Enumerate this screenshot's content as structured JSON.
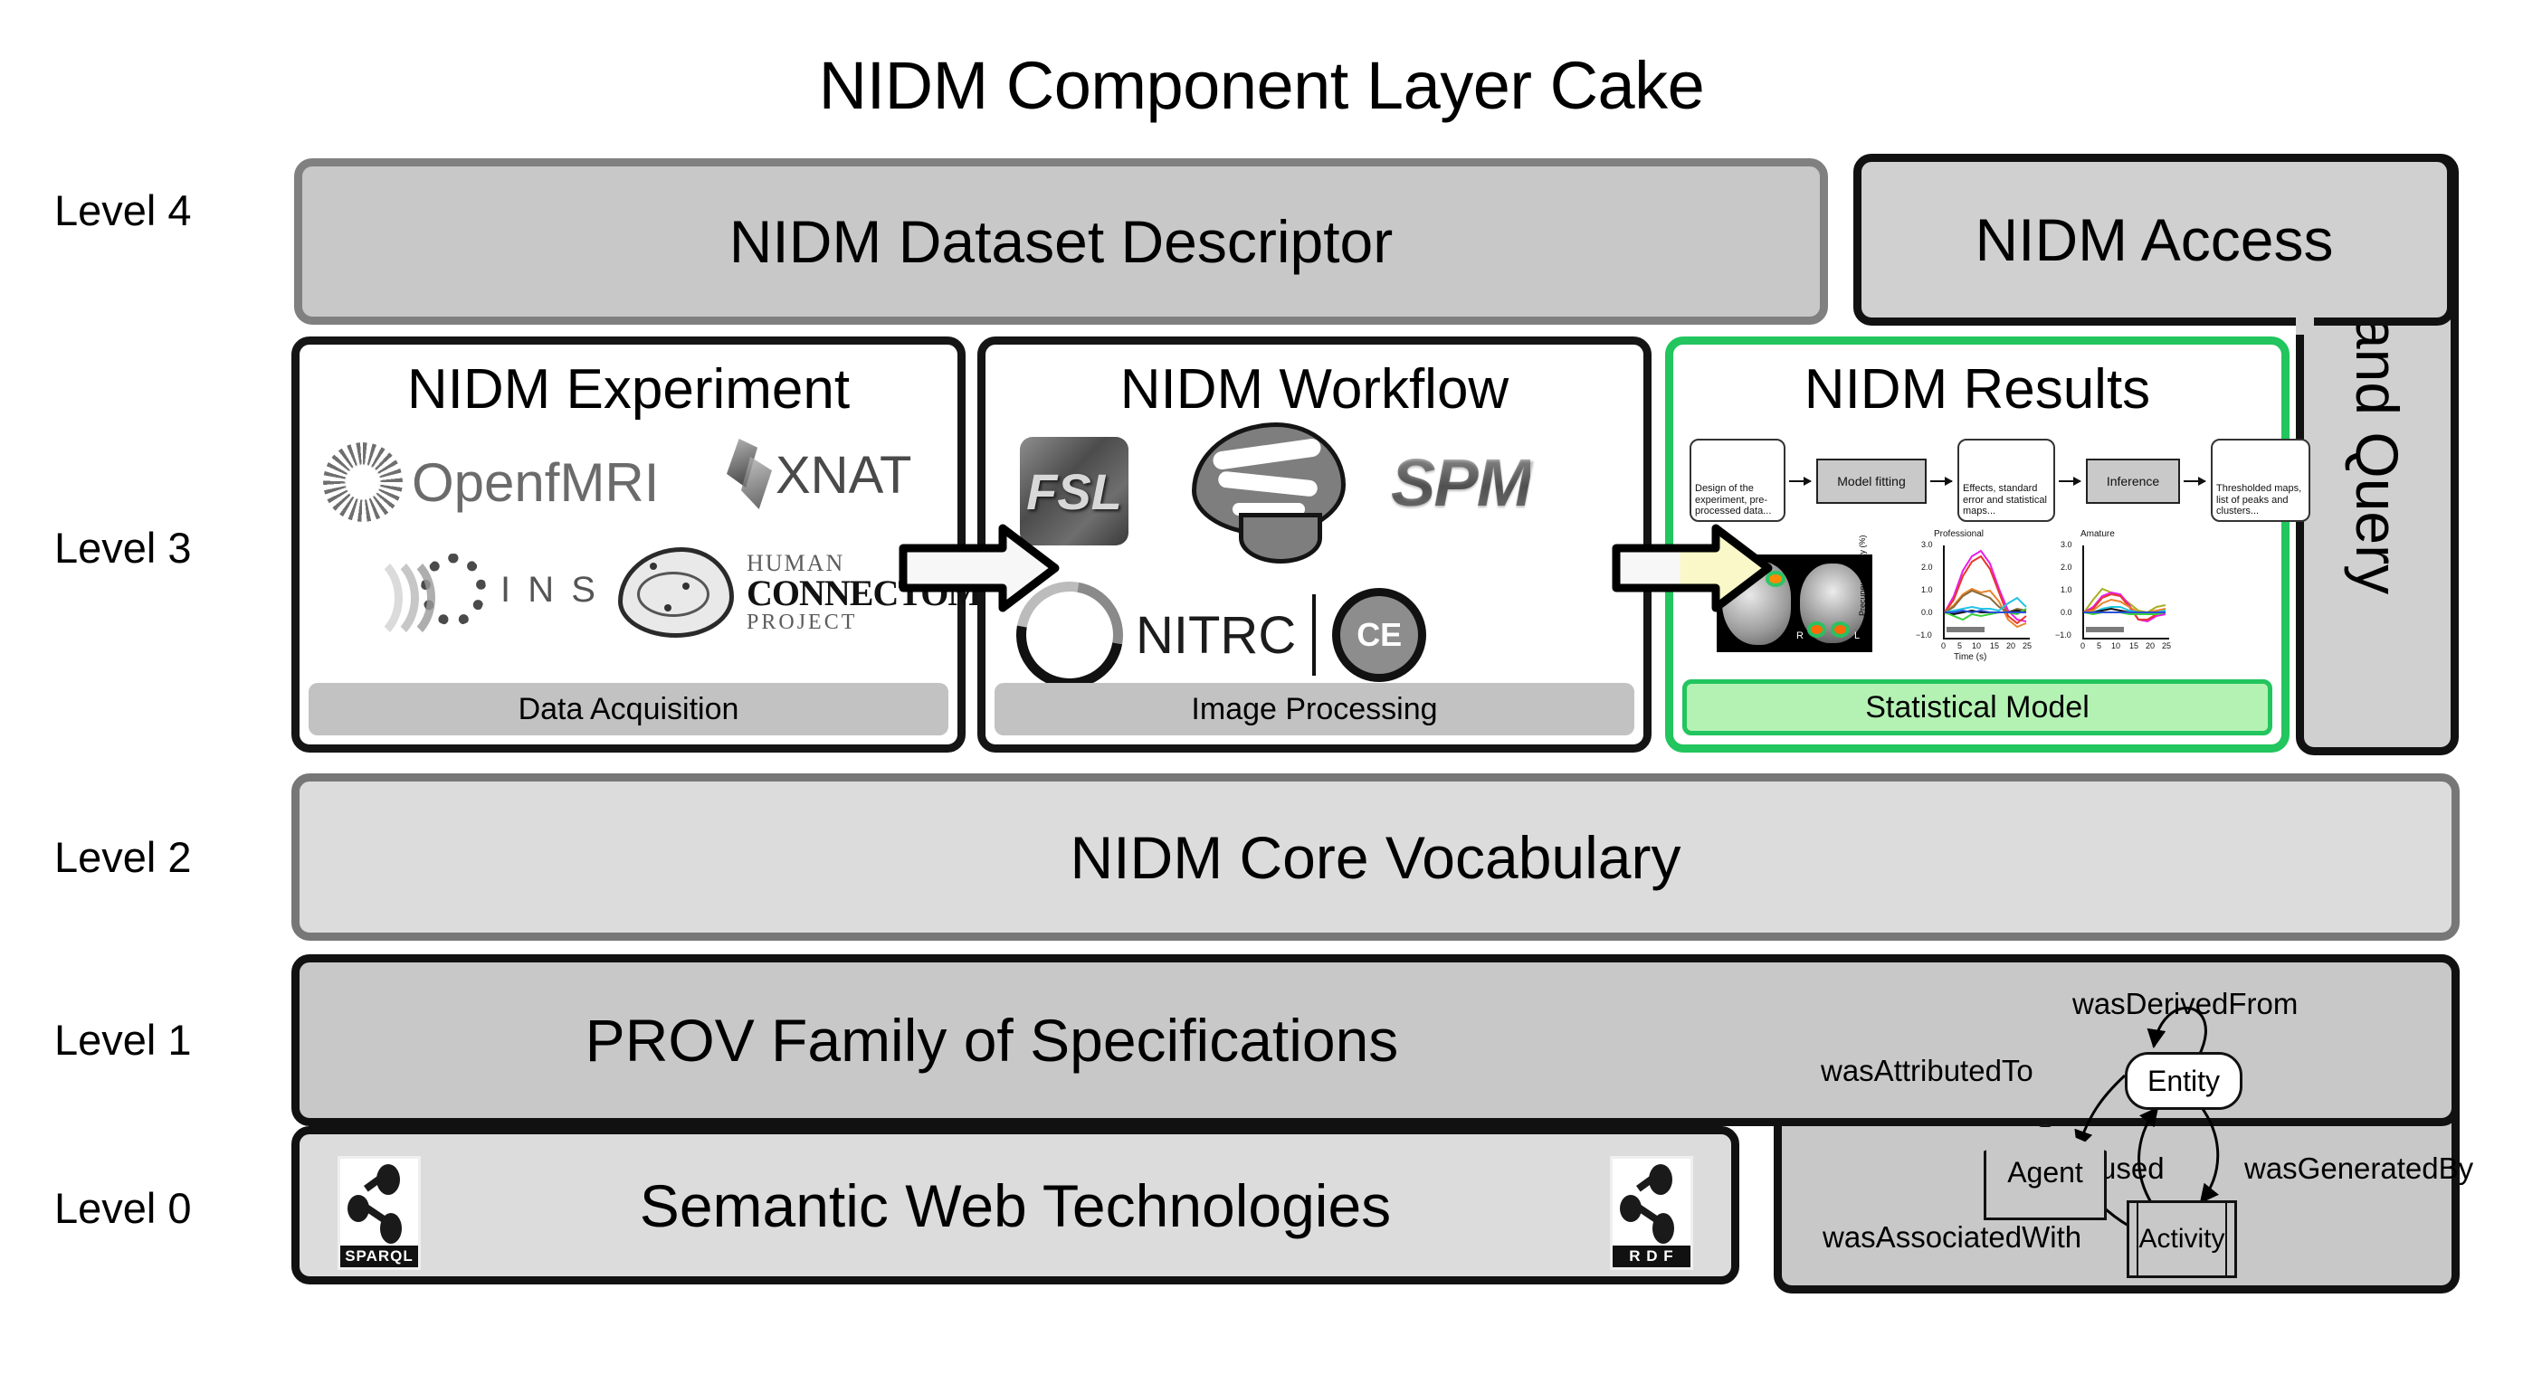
{
  "title": "NIDM Component Layer Cake",
  "levels": [
    {
      "label": "Level 4"
    },
    {
      "label": "Level 3"
    },
    {
      "label": "Level 2"
    },
    {
      "label": "Level 1"
    },
    {
      "label": "Level 0"
    }
  ],
  "level4": {
    "dataset_descriptor": "NIDM Dataset Descriptor",
    "access": "NIDM Access",
    "and_query": "and Query"
  },
  "level3": {
    "experiment": {
      "title": "NIDM Experiment",
      "footer": "Data Acquisition",
      "logos": [
        {
          "name": "openfmri-logo",
          "label": "OpenfMRI"
        },
        {
          "name": "xnat-logo",
          "label": "XNAT"
        },
        {
          "name": "ins-logo",
          "label": "I N S"
        },
        {
          "name": "human-connectome-project-logo",
          "line1": "HUMAN",
          "line2": "CONNECTOME",
          "line3": "PROJECT"
        }
      ]
    },
    "workflow": {
      "title": "NIDM Workflow",
      "footer": "Image Processing",
      "logos": [
        {
          "name": "fsl-logo",
          "label": "FSL"
        },
        {
          "name": "nipype-brain-logo",
          "label": ""
        },
        {
          "name": "spm-logo",
          "label": "SPM"
        },
        {
          "name": "nitrc-logo",
          "label": "NITRC"
        },
        {
          "name": "nitrc-ce-logo",
          "label": "CE"
        }
      ]
    },
    "results": {
      "title": "NIDM Results",
      "footer": "Statistical Model",
      "pipeline": [
        {
          "type": "data",
          "text": "Design of the experiment, pre-processed data..."
        },
        {
          "type": "process",
          "text": "Model fitting"
        },
        {
          "type": "data",
          "text": "Effects, standard error and statistical maps..."
        },
        {
          "type": "process",
          "text": "Inference"
        },
        {
          "type": "data",
          "text": "Thresholded maps, list of peaks and clusters..."
        }
      ],
      "brain_labels": {
        "right": "R",
        "left": "L"
      },
      "plots": [
        {
          "title": "Professional",
          "ylabel": "Precuneus activity (%)",
          "xlabel": "Time (s)",
          "yticks": [
            "3.0",
            "2.0",
            "1.0",
            "0.0",
            "−1.0"
          ],
          "xticks": [
            "0",
            "5",
            "10",
            "15",
            "20",
            "25"
          ]
        },
        {
          "title": "Amature",
          "ylabel": "",
          "xlabel": "",
          "yticks": [
            "3.0",
            "2.0",
            "1.0",
            "0.0",
            "−1.0"
          ],
          "xticks": [
            "0",
            "5",
            "10",
            "15",
            "20",
            "25"
          ]
        }
      ]
    }
  },
  "level2": {
    "text": "NIDM Core Vocabulary"
  },
  "level1": {
    "text": "PROV Family of Specifications",
    "prov": {
      "nodes": [
        {
          "name": "entity",
          "label": "Entity"
        },
        {
          "name": "agent",
          "label": "Agent"
        },
        {
          "name": "activity",
          "label": "Activity"
        }
      ],
      "edges": [
        {
          "label": "wasDerivedFrom"
        },
        {
          "label": "wasAttributedTo"
        },
        {
          "label": "used"
        },
        {
          "label": "wasGeneratedBy"
        },
        {
          "label": "wasAssociatedWith"
        }
      ]
    }
  },
  "level0": {
    "text": "Semantic Web Technologies",
    "badges": [
      {
        "name": "sparql-logo",
        "label": "SPARQL"
      },
      {
        "name": "rdf-logo",
        "label": "R D F"
      }
    ]
  },
  "colors": {
    "results_accent": "#22c55e",
    "results_footer_fill": "#b4f2b4",
    "level4_fill": "#c8c8c8",
    "level2_fill": "#dcdcdc",
    "level1_fill": "#c8c8c8",
    "arrow_yellow": "#faf8c8"
  }
}
